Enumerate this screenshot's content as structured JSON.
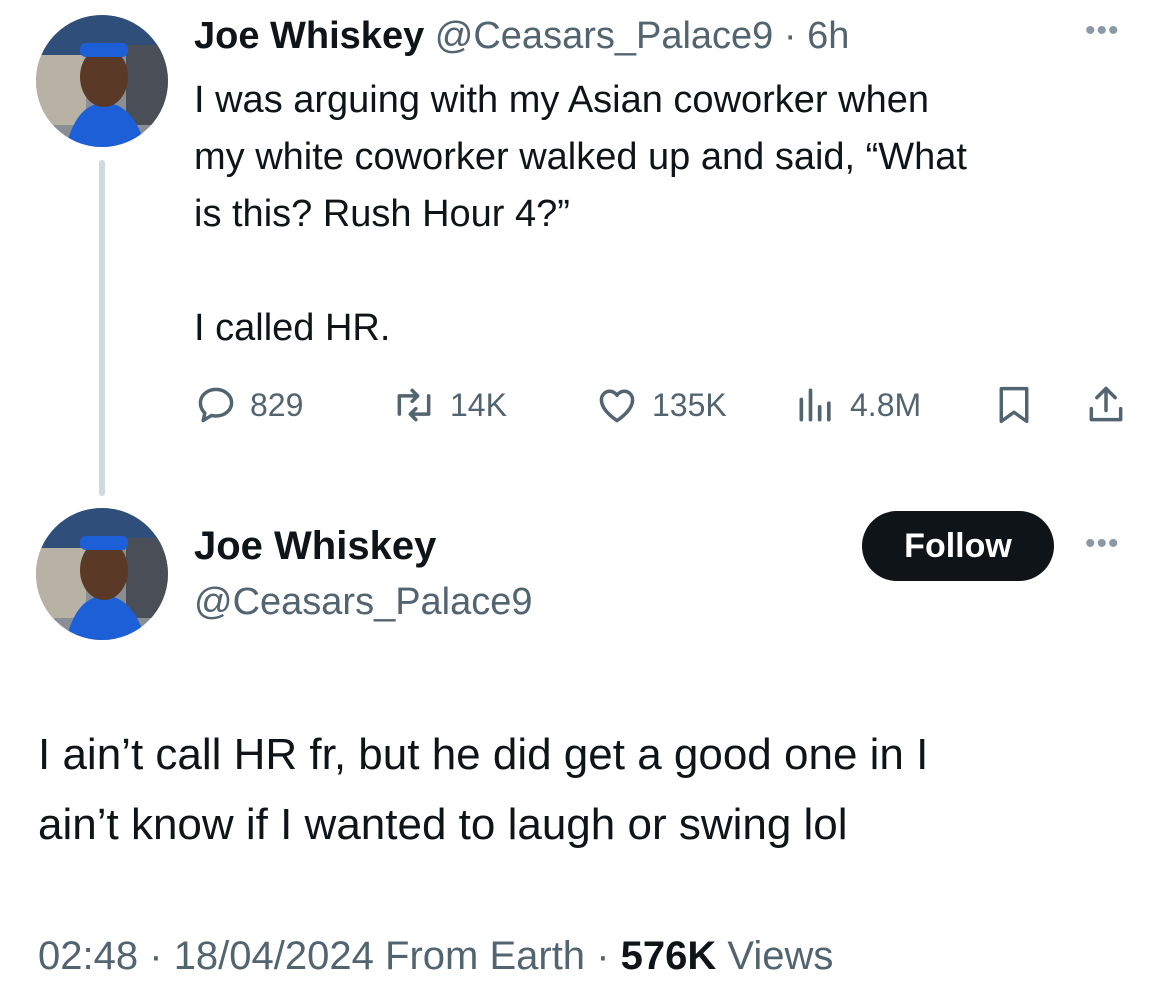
{
  "tweet1": {
    "author_name": "Joe Whiskey",
    "handle": "@Ceasars_Palace9",
    "separator": "·",
    "time": "6h",
    "more": "•••",
    "lines": [
      "I was arguing with my Asian coworker when",
      "my white coworker walked up and said, “What",
      "is this? Rush Hour 4?”",
      "I called HR."
    ],
    "actions": {
      "replies": "829",
      "reposts": "14K",
      "likes": "135K",
      "views": "4.8M"
    }
  },
  "tweet2": {
    "author_name": "Joe Whiskey",
    "handle": "@Ceasars_Palace9",
    "follow_label": "Follow",
    "more": "•••",
    "lines": [
      "I ain’t call HR fr, but he did get a good one in I",
      "ain’t know if I wanted to laugh or swing lol"
    ],
    "time": "02:48",
    "separator": "·",
    "date": "18/04/2024",
    "source": "From Earth",
    "views_count": "576K",
    "views_label": "Views"
  },
  "icons": [
    "avatar",
    "reply-icon",
    "repost-icon",
    "like-icon",
    "views-icon",
    "bookmark-icon",
    "share-icon",
    "more-icon"
  ],
  "colors": {
    "text": "#0f1419",
    "muted": "#536471",
    "thread_line": "#cfd9de",
    "follow_bg": "#0f1419",
    "avatar_shirt": "#1d5fd6"
  }
}
